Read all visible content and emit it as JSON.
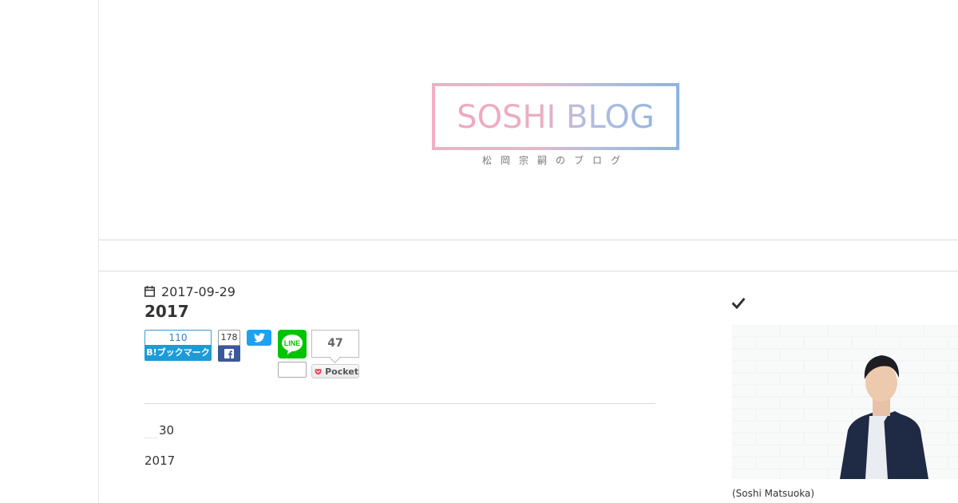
{
  "header": {
    "logo_text": "SOSHI BLOG",
    "logo_subtitle": "松岡宗嗣のブログ"
  },
  "entry": {
    "date": "2017-09-29",
    "title": "2017",
    "paragraphs": [
      "30",
      "2017"
    ]
  },
  "share": {
    "hatena_count": "110",
    "hatena_label": "B!ブックマーク",
    "facebook_count": "178",
    "line_label": "LINE",
    "line_count": "",
    "pocket_count": "47",
    "pocket_label": "Pocket"
  },
  "sidebar": {
    "profile_caption": "(Soshi Matsuoka)"
  },
  "colors": {
    "hatena": "#1d9bd6",
    "facebook": "#3b5998",
    "twitter": "#1da1f2",
    "line": "#00c300",
    "pocket": "#ef3f56",
    "logo_pink": "#f0a7be",
    "logo_blue": "#8db3dc"
  },
  "icons": [
    "calendar-icon",
    "facebook-icon",
    "twitter-icon",
    "line-icon",
    "pocket-icon",
    "check-icon"
  ]
}
